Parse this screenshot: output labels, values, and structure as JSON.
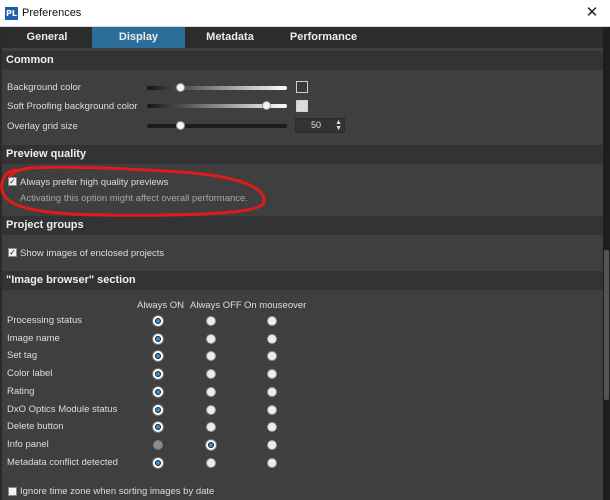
{
  "window": {
    "title": "Preferences",
    "logo_text": "PL",
    "close_glyph": "✕"
  },
  "tabs": [
    {
      "label": "General",
      "active": false
    },
    {
      "label": "Display",
      "active": true
    },
    {
      "label": "Metadata",
      "active": false
    },
    {
      "label": "Performance",
      "active": false
    }
  ],
  "common": {
    "header": "Common",
    "background_color": {
      "label": "Background color",
      "level": 0.2,
      "swatch": "#3a3a3a"
    },
    "soft_proofing": {
      "label": "Soft Proofing background color",
      "level": 0.82,
      "swatch": "#dcdcdc"
    },
    "overlay_grid": {
      "label": "Overlay grid size",
      "level": 0.2,
      "value": "50"
    }
  },
  "preview_quality": {
    "header": "Preview quality",
    "checkbox_label": "Always prefer high quality previews",
    "checked": true,
    "hint": "Activating this option might affect overall performance."
  },
  "project_groups": {
    "header": "Project groups",
    "checkbox_label": "Show images of enclosed projects",
    "checked": true
  },
  "image_browser": {
    "header": "\"Image browser\" section",
    "columns": [
      "Always ON",
      "Always OFF",
      "On mouseover"
    ],
    "rows": [
      {
        "label": "Processing status",
        "selected": 0
      },
      {
        "label": "Image name",
        "selected": 0
      },
      {
        "label": "Set tag",
        "selected": 0
      },
      {
        "label": "Color label",
        "selected": 0
      },
      {
        "label": "Rating",
        "selected": 0
      },
      {
        "label": "DxO Optics Module status",
        "selected": 0
      },
      {
        "label": "Delete button",
        "selected": 0
      },
      {
        "label": "Info panel",
        "selected": 1,
        "disabled_column": 0
      },
      {
        "label": "Metadata conflict detected",
        "selected": 0
      }
    ]
  },
  "footer": {
    "checkbox_label": "Ignore time zone when sorting images by date",
    "checked": false
  },
  "colors": {
    "accent_tab": "#2b6f99",
    "radio_dot": "#3d8ec9",
    "annotation": "#e01b1b"
  }
}
